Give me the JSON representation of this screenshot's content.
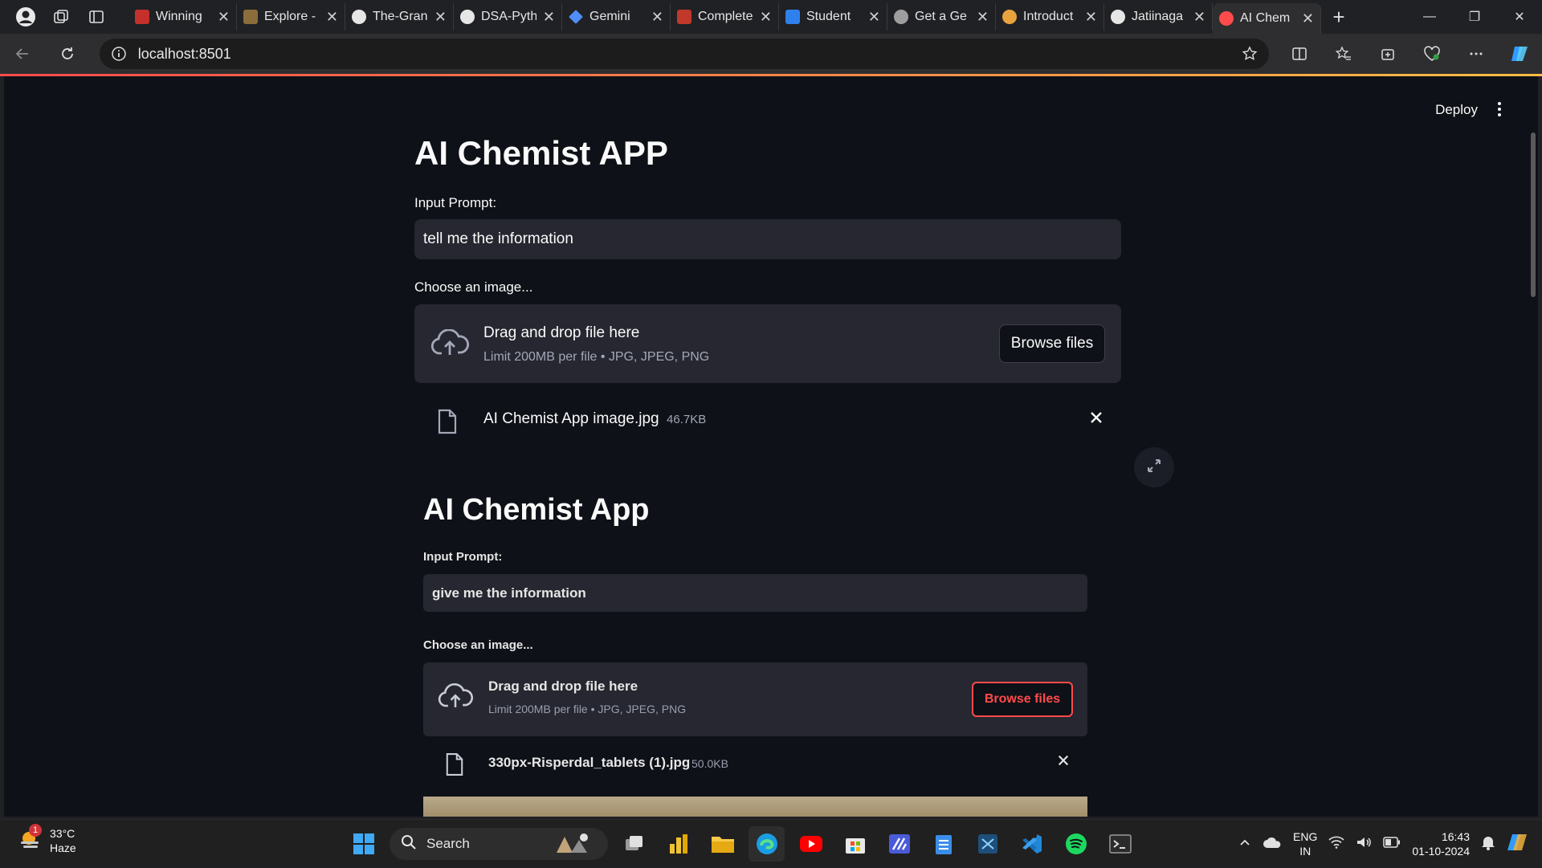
{
  "browser": {
    "tabs": [
      {
        "label": "Winning",
        "favicon_color": "#c4302b"
      },
      {
        "label": "Explore -",
        "favicon_color": "#8a6d3b"
      },
      {
        "label": "The-Gran",
        "favicon_color": "#e6e6e6"
      },
      {
        "label": "DSA-Pyth",
        "favicon_color": "#e6e6e6"
      },
      {
        "label": "Gemini",
        "favicon_color": "#4f8ef7"
      },
      {
        "label": "Complete",
        "favicon_color": "#c0392b"
      },
      {
        "label": "Student",
        "favicon_color": "#2f80ed"
      },
      {
        "label": "Get a Ge",
        "favicon_color": "#9e9e9e"
      },
      {
        "label": "Introduct",
        "favicon_color": "#e8a33d"
      },
      {
        "label": "Jatiinaga",
        "favicon_color": "#e6e6e6"
      },
      {
        "label": "AI Chem",
        "favicon_color": "#ff4b4b",
        "active": true
      }
    ],
    "address": "localhost:8501"
  },
  "app": {
    "deploy_label": "Deploy",
    "title": "AI Chemist APP",
    "input_label": "Input Prompt:",
    "input_value": "tell me the information",
    "uploader_label": "Choose an image...",
    "dropzone_title": "Drag and drop file here",
    "dropzone_limit": "Limit 200MB per file • JPG, JPEG, PNG",
    "browse_label": "Browse files",
    "file_name": "AI Chemist App image.jpg",
    "file_size": "46.7KB"
  },
  "preview": {
    "title": "AI Chemist App",
    "input_label": "Input Prompt:",
    "input_value": "give me the information",
    "uploader_label": "Choose an image...",
    "dropzone_title": "Drag and drop file here",
    "dropzone_limit": "Limit 200MB per file • JPG, JPEG, PNG",
    "browse_label": "Browse files",
    "file_name": "330px-Risperdal_tablets (1).jpg",
    "file_size": "50.0KB"
  },
  "taskbar": {
    "weather_temp": "33°C",
    "weather_desc": "Haze",
    "weather_badge": "1",
    "search_label": "Search",
    "lang_top": "ENG",
    "lang_bottom": "IN",
    "time": "16:43",
    "date": "01-10-2024"
  },
  "colors": {
    "accent": "#ff4b4b",
    "app_bg": "#0e1117",
    "widget_bg": "#262730"
  }
}
